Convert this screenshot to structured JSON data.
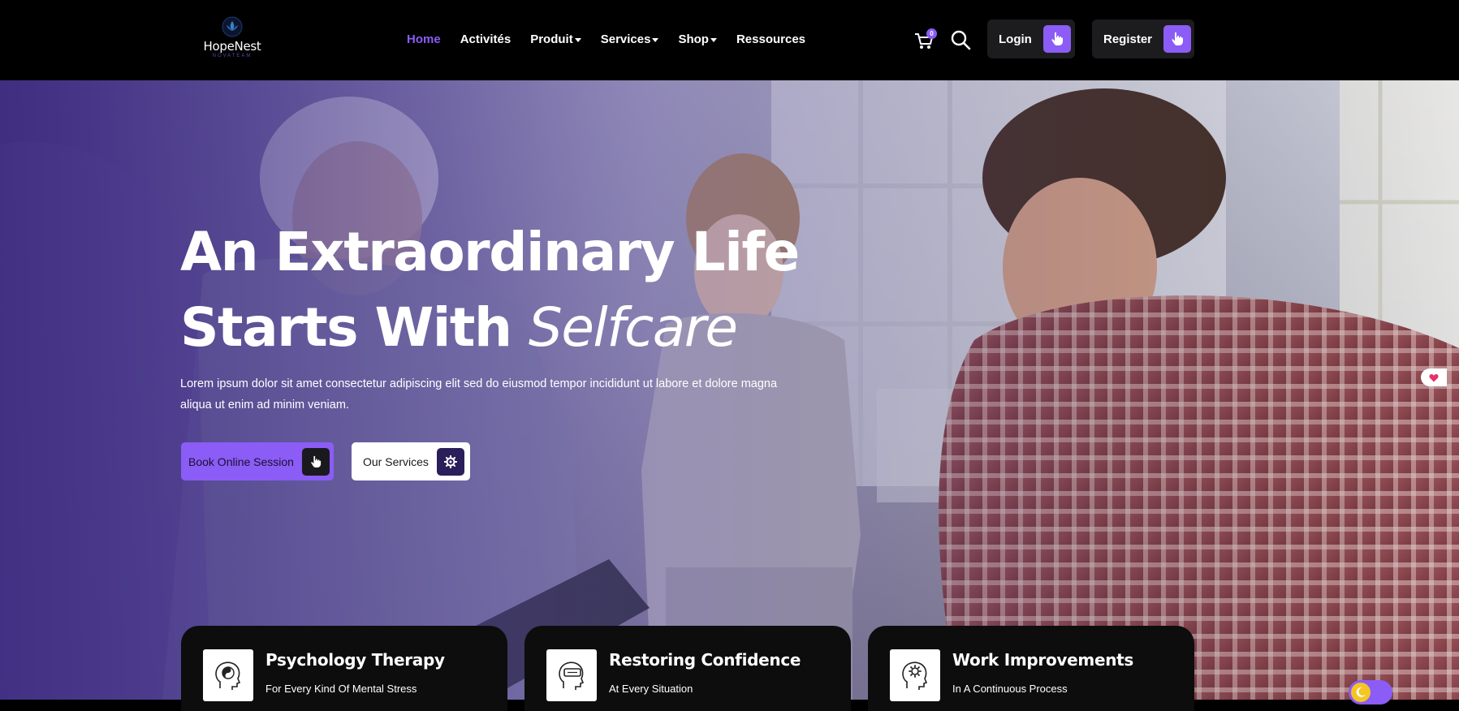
{
  "brand": {
    "name": "HopeNest",
    "tagline": "NOVATEAM",
    "accent": "#8b5cf6"
  },
  "nav": {
    "items": [
      {
        "label": "Home",
        "active": true,
        "dropdown": false
      },
      {
        "label": "Activités",
        "active": false,
        "dropdown": false
      },
      {
        "label": "Produit",
        "active": false,
        "dropdown": true
      },
      {
        "label": "Services",
        "active": false,
        "dropdown": true
      },
      {
        "label": "Shop",
        "active": false,
        "dropdown": true
      },
      {
        "label": "Ressources",
        "active": false,
        "dropdown": false
      }
    ]
  },
  "header": {
    "cart_count": "0",
    "cart_icon": "cart-icon",
    "search_icon": "search-icon",
    "login_label": "Login",
    "register_label": "Register"
  },
  "hero": {
    "title_line1": "An Extraordinary Life",
    "title_line2_plain": "Starts With ",
    "title_line2_italic": "Selfcare",
    "text": "Lorem ipsum dolor sit amet consectetur adipiscing elit sed do eiusmod tempor incididunt ut labore et dolore magna aliqua ut enim ad minim veniam.",
    "book_label": "Book Online Session",
    "services_label": "Our Services"
  },
  "cards": [
    {
      "title": "Psychology Therapy",
      "subtitle": "For Every Kind Of Mental Stress",
      "icon": "mind-yin-yang-icon"
    },
    {
      "title": "Restoring Confidence",
      "subtitle": "At Every Situation",
      "icon": "vr-head-icon"
    },
    {
      "title": "Work Improvements",
      "subtitle": "In A Continuous Process",
      "icon": "mind-gear-icon"
    }
  ],
  "theme_toggle": {
    "icon": "moon-icon",
    "mode": "dark"
  }
}
